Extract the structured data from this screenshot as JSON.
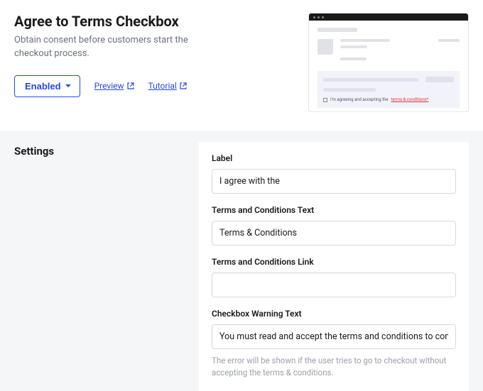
{
  "header": {
    "title": "Agree to Terms Checkbox",
    "description": "Obtain consent before customers start the checkout process.",
    "enabled_label": "Enabled",
    "preview_link": "Preview",
    "tutorial_link": "Tutorial"
  },
  "preview_thumb": {
    "consent_prefix": "I'm agreeing and accepting the ",
    "consent_link": "terms & conditions*"
  },
  "settings": {
    "section_title": "Settings",
    "fields": {
      "label": {
        "label": "Label",
        "value": "I agree with the"
      },
      "terms_text": {
        "label": "Terms and Conditions Text",
        "value": "Terms & Conditions"
      },
      "terms_link": {
        "label": "Terms and Conditions Link",
        "value": ""
      },
      "warning": {
        "label": "Checkbox Warning Text",
        "value": "You must read and accept the terms and conditions to complete checkout.",
        "help": "The error will be shown if the user tries to go to checkout without accepting the terms & conditions."
      }
    }
  }
}
